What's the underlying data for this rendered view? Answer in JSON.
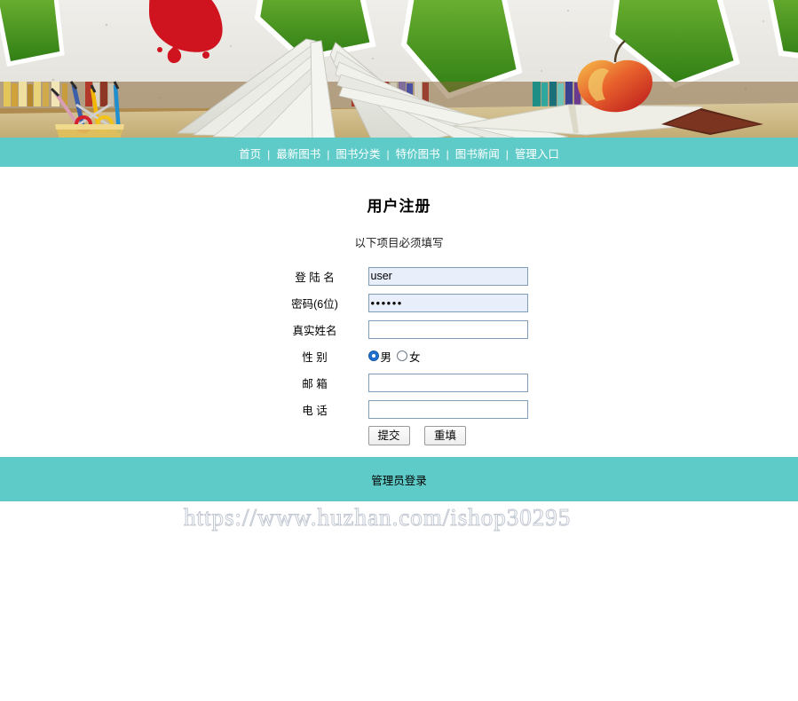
{
  "banner": {
    "alt": "book-shop-banner",
    "description": "Colorful school/book themed header with open book, bookshelf, apple, pencils and scissors"
  },
  "nav": {
    "separator": "|",
    "items": [
      {
        "label": "首页",
        "name": "nav-home"
      },
      {
        "label": "最新图书",
        "name": "nav-newest-books"
      },
      {
        "label": "图书分类",
        "name": "nav-book-categories"
      },
      {
        "label": "特价图书",
        "name": "nav-special-price-books"
      },
      {
        "label": "图书新闻",
        "name": "nav-book-news"
      },
      {
        "label": "管理入口",
        "name": "nav-admin-entry"
      }
    ]
  },
  "page": {
    "title": "用户注册",
    "note": "以下项目必须填写"
  },
  "form": {
    "fields": [
      {
        "label": "登 陆 名",
        "type": "text",
        "value": "user",
        "placeholder": "",
        "autofilled": true
      },
      {
        "label": "密码(6位)",
        "type": "password",
        "value": "••••••",
        "placeholder": "",
        "autofilled": true
      },
      {
        "label": "真实姓名",
        "type": "text",
        "value": "",
        "placeholder": "",
        "autofilled": false
      },
      {
        "label": "性  别",
        "type": "radio",
        "options": [
          {
            "label": "男",
            "checked": true
          },
          {
            "label": "女",
            "checked": false
          }
        ]
      },
      {
        "label": "邮  箱",
        "type": "text",
        "value": "",
        "placeholder": "",
        "autofilled": false
      },
      {
        "label": "电  话",
        "type": "text",
        "value": "",
        "placeholder": "",
        "autofilled": false
      }
    ],
    "submit_label": "提交",
    "reset_label": "重填"
  },
  "footer": {
    "admin_login_label": "管理员登录"
  },
  "watermark": {
    "text": "https://www.huzhan.com/ishop30295"
  },
  "colors": {
    "teal": "#5fcbc8",
    "autofill": "#e8eefa",
    "input_border": "#7f9db9",
    "radio_checked": "#1f6fd0"
  }
}
